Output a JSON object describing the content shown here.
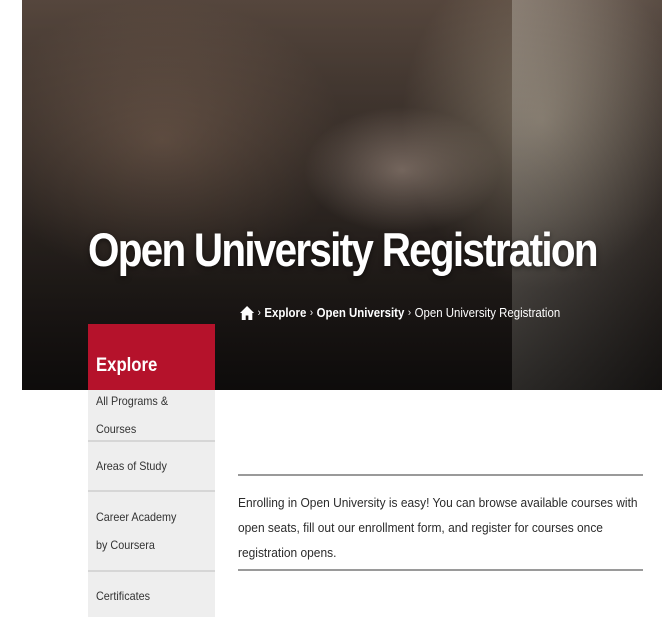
{
  "hero": {
    "title": "Open University Registration"
  },
  "breadcrumb": {
    "items": [
      {
        "label": "Explore"
      },
      {
        "label": "Open University"
      },
      {
        "label": "Open University Registration"
      }
    ],
    "separator": "›"
  },
  "sidebar": {
    "header": "Explore",
    "items": [
      {
        "label": "All Programs & Courses"
      },
      {
        "label": "Areas of Study"
      },
      {
        "label": "Career Academy by Coursera"
      },
      {
        "label": "Certificates"
      }
    ]
  },
  "main": {
    "intro": "Enrolling in Open University is easy! You can browse available courses with open seats, fill out our enrollment form, and register for courses once registration opens."
  },
  "colors": {
    "accent": "#b5122b",
    "sidebar_bg": "#eeeeee",
    "divider": "#9a9a9a"
  },
  "icons": {
    "home": "home-icon"
  }
}
